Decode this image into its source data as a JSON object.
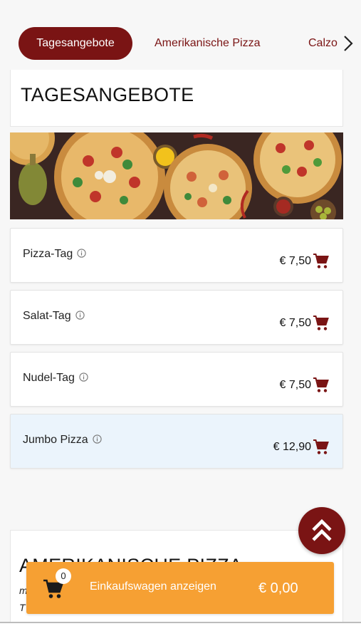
{
  "tabs": {
    "items": [
      {
        "label": "Tagesangebote",
        "active": true
      },
      {
        "label": "Amerikanische Pizza",
        "active": false
      },
      {
        "label": "Calzo",
        "active": false
      }
    ],
    "chevron_icon": "chevron-right-icon"
  },
  "section": {
    "title": "TAGESANGEBOTE",
    "banner_icon": "pizza-banner-image"
  },
  "items": [
    {
      "name": "Pizza-Tag",
      "price": "€ 7,50"
    },
    {
      "name": "Salat-Tag",
      "price": "€ 7,50"
    },
    {
      "name": "Nudel-Tag",
      "price": "€ 7,50"
    },
    {
      "name": "Jumbo Pizza",
      "price": "€ 12,90",
      "highlighted": true
    }
  ],
  "next_section": {
    "title": "AMERIKANISCHE PIZZA",
    "sub1": "m",
    "sub2": "T"
  },
  "cart": {
    "count": "0",
    "label": "Einkaufswagen anzeigen",
    "total": "€ 0,00"
  },
  "colors": {
    "accent": "#7a1414",
    "cart_bar": "#f6a033",
    "highlight": "#ebf4fc"
  }
}
